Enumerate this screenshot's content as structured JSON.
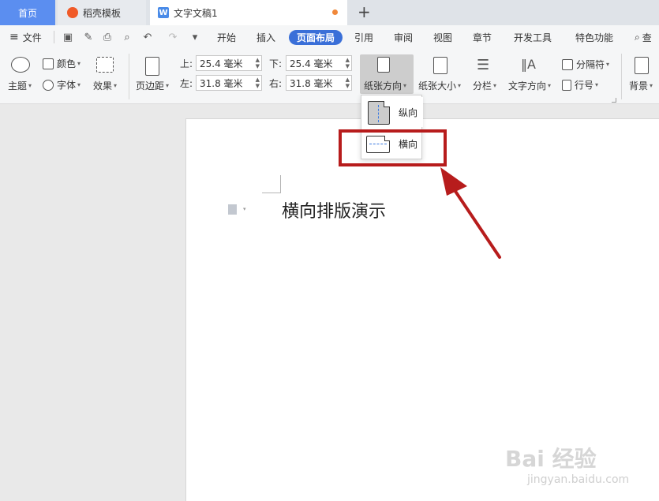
{
  "tabs": {
    "home": "首页",
    "template": "稻壳模板",
    "document": "文字文稿1",
    "doc_icon": "W",
    "unsaved_dot_color": "#f0883a",
    "new_tab": "+"
  },
  "menu": {
    "file": "文件",
    "items": [
      "开始",
      "插入",
      "页面布局",
      "引用",
      "审阅",
      "视图",
      "章节",
      "开发工具",
      "特色功能"
    ],
    "active": "页面布局",
    "search": "查"
  },
  "ribbon": {
    "theme": "主题",
    "colors": "颜色",
    "fonts": "字体",
    "effects": "效果",
    "margins": "页边距",
    "top_label": "上:",
    "top_value": "25.4 毫米",
    "bottom_label": "下:",
    "bottom_value": "25.4 毫米",
    "left_label": "左:",
    "left_value": "31.8 毫米",
    "right_label": "右:",
    "right_value": "31.8 毫米",
    "orientation": "纸张方向",
    "paper_size": "纸张大小",
    "columns": "分栏",
    "text_direction": "文字方向",
    "breaks": "分隔符",
    "line_numbers": "行号",
    "background": "背景"
  },
  "dropdown": {
    "portrait": "纵向",
    "landscape": "横向"
  },
  "document": {
    "text": "横向排版演示"
  },
  "annotation": {
    "color": "#b71c1c"
  },
  "watermark": {
    "brand": "Bai 经验",
    "url": "jingyan.baidu.com"
  }
}
